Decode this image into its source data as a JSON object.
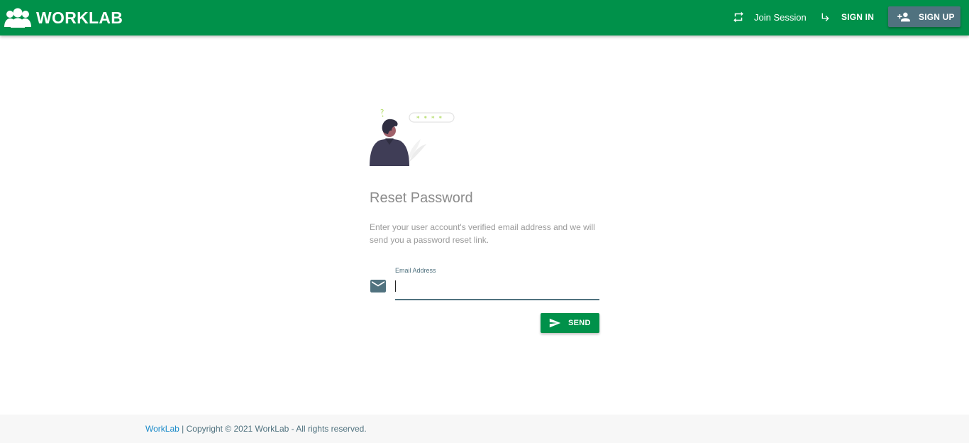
{
  "header": {
    "brand": "WORKLAB",
    "nav": {
      "join_session": "Join Session",
      "sign_in": "SIGN IN",
      "sign_up": "SIGN UP"
    }
  },
  "main": {
    "title": "Reset Password",
    "description": "Enter your user account's verified email address and we will send you a password reset link.",
    "email_field": {
      "label": "Email Address",
      "value": ""
    },
    "send_button": "SEND"
  },
  "footer": {
    "link": "WorkLab",
    "text": " | Copyright © 2021 WorkLab - All rights reserved."
  },
  "colors": {
    "primary": "#00914a",
    "secondary": "#50727f",
    "link": "#1c8bc9"
  },
  "icons": {
    "brand": "group-icon",
    "join_session": "repeat-icon",
    "sign_in": "subdirectory-arrow-icon",
    "sign_up": "person-add-icon",
    "email": "mail-icon",
    "send": "send-icon"
  }
}
